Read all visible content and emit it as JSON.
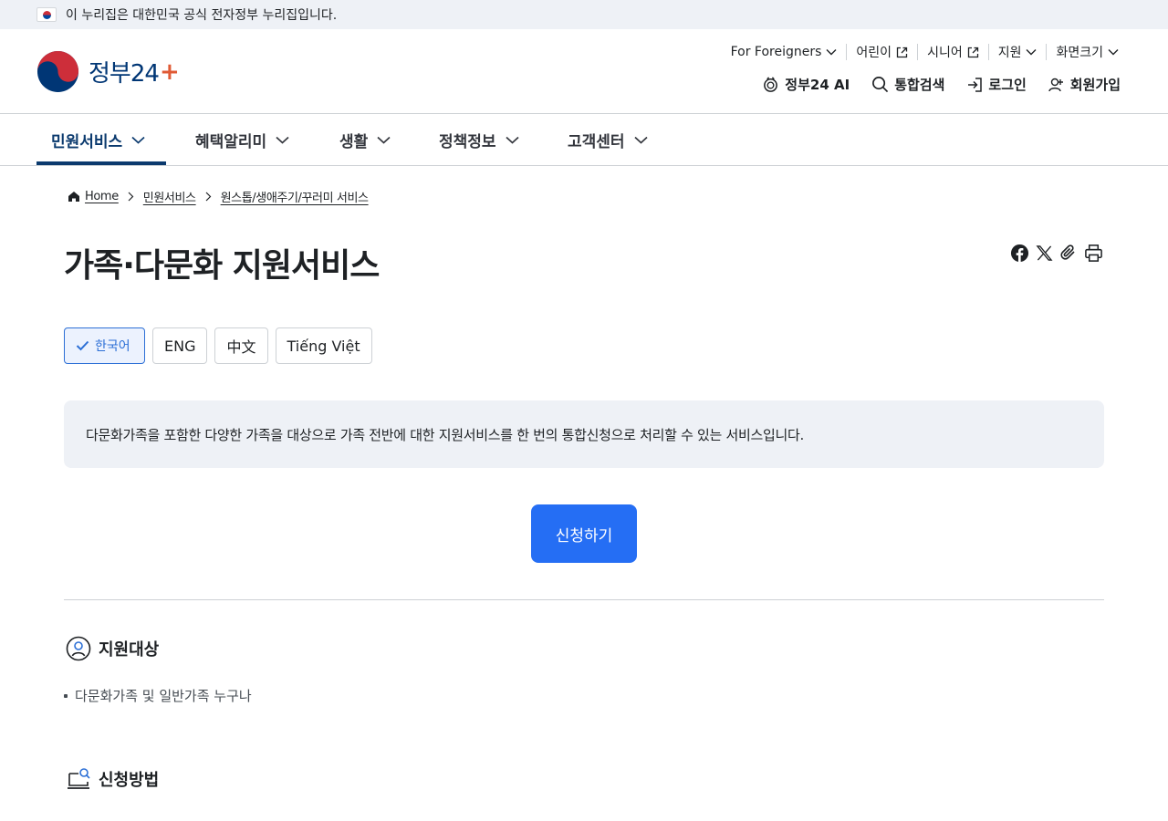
{
  "gov_banner": {
    "text": "이 누리집은 대한민국 공식 전자정부 누리집입니다."
  },
  "logo": {
    "text": "정부24"
  },
  "util_top": [
    {
      "label": "For Foreigners",
      "icon": "chevron-down-icon"
    },
    {
      "label": "어린이",
      "icon": "external-link-icon"
    },
    {
      "label": "시니어",
      "icon": "external-link-icon"
    },
    {
      "label": "지원",
      "icon": "chevron-down-icon"
    },
    {
      "label": "화면크기",
      "icon": "chevron-down-icon"
    }
  ],
  "util_bottom": [
    {
      "label": "정부24 AI",
      "icon": "ai-icon"
    },
    {
      "label": "통합검색",
      "icon": "search-icon"
    },
    {
      "label": "로그인",
      "icon": "login-icon"
    },
    {
      "label": "회원가입",
      "icon": "add-user-icon"
    }
  ],
  "gnb": [
    {
      "label": "민원서비스",
      "active": true
    },
    {
      "label": "혜택알리미"
    },
    {
      "label": "생활"
    },
    {
      "label": "정책정보"
    },
    {
      "label": "고객센터"
    }
  ],
  "breadcrumb": [
    "Home",
    "민원서비스",
    "원스톱/생애주기/꾸러미 서비스"
  ],
  "page_title": "가족·다문화 지원서비스",
  "languages": [
    {
      "label": "한국어",
      "selected": true
    },
    {
      "label": "ENG"
    },
    {
      "label": "中文"
    },
    {
      "label": "Tiếng Việt"
    }
  ],
  "description": "다문화가족을 포함한 다양한 가족을 대상으로 가족 전반에 대한 지원서비스를 한 번의 통합신청으로 처리할 수 있는 서비스입니다.",
  "apply_button": "신청하기",
  "sections": {
    "target": {
      "title": "지원대상",
      "items": [
        "다문화가족 및 일반가족 누구나"
      ]
    },
    "method": {
      "title": "신청방법"
    }
  },
  "colors": {
    "primary": "#256ef4",
    "navy": "#0b3a6e",
    "bg_gray": "#eef1f6",
    "border": "#cdd1d5"
  }
}
